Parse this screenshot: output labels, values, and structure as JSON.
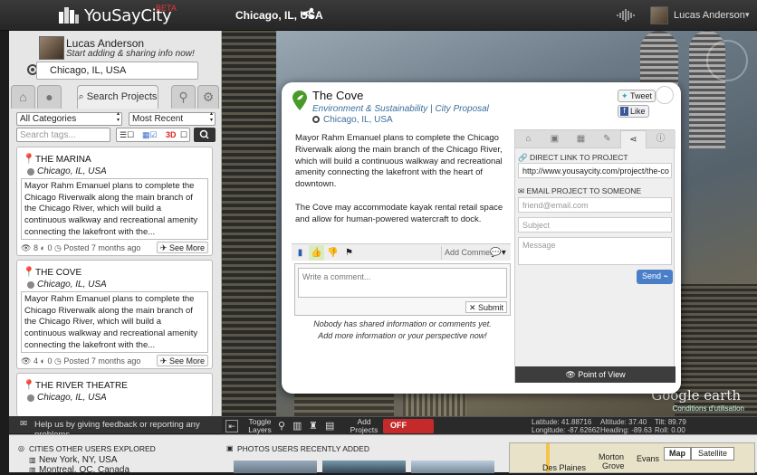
{
  "header": {
    "brand": "YouSayCity",
    "beta": "BETA",
    "location": "Chicago, IL, USA",
    "user_name": "Lucas Anderson"
  },
  "sidebar": {
    "user_name": "Lucas Anderson",
    "tagline": "Start adding & sharing info now!",
    "location_value": "Chicago, IL, USA",
    "tabs": [
      "home",
      "user",
      "Search Projects",
      "pin",
      "settings"
    ],
    "active_tab": "Search Projects",
    "category_select": "All Categories",
    "sort_select": "Most Recent",
    "tags_placeholder": "Search tags...",
    "toggle_3d": "3D",
    "projects": [
      {
        "title": "THE MARINA",
        "location": "Chicago, IL, USA",
        "body": "Mayor Rahm Emanuel plans to complete the Chicago Riverwalk along the main branch of the Chicago River, which will build a continuous walkway and recreational amenity connecting the lakefront with the...",
        "views": "8",
        "comments": "0",
        "posted": "Posted 7 months ago",
        "see_more": "See More"
      },
      {
        "title": "THE COVE",
        "location": "Chicago, IL, USA",
        "body": "Mayor Rahm Emanuel plans to complete the Chicago Riverwalk along the main branch of the Chicago River, which will build a continuous walkway and recreational amenity connecting the lakefront with the...",
        "views": "4",
        "comments": "0",
        "posted": "Posted 7 months ago",
        "see_more": "See More"
      },
      {
        "title": "THE RIVER THEATRE",
        "location": "Chicago, IL, USA"
      }
    ],
    "feedback": "Help us by giving feedback or reporting any problems"
  },
  "popup": {
    "title": "The Cove",
    "category": "Environment & Sustainability | City Proposal",
    "location": "Chicago, IL, USA",
    "tweet": "Tweet",
    "like": "Like",
    "description_1": "Mayor Rahm Emanuel plans to complete the Chicago Riverwalk along the main branch of the Chicago River, which will build a continuous walkway and recreational amenity connecting the lakefront with the heart of downtown.",
    "description_2": "The Cove may accommodate kayak rental retail space and allow for human-powered watercraft to dock.",
    "add_comment": "Add Comment",
    "comment_placeholder": "Write a comment...",
    "submit": "Submit",
    "nobody_1": "Nobody has shared information or comments yet.",
    "nobody_2": "Add more information or your perspective now!",
    "direct_link_label": "DIRECT LINK TO PROJECT",
    "direct_link_value": "http://www.yousaycity.com/project/the-co",
    "email_label": "EMAIL PROJECT TO SOMEONE",
    "email_placeholder": "friend@email.com",
    "subject_placeholder": "Subject",
    "message_placeholder": "Message",
    "send": "Send",
    "point_of_view": "Point of View"
  },
  "map": {
    "google_earth": "Google earth",
    "conditions": "Conditions d'utilisation",
    "toggle_layers": "Toggle Layers",
    "add_projects": "Add Projects",
    "off": "OFF",
    "latitude": "Latitude: 41.88716",
    "longitude": "Longitude: -87.62662",
    "altitude": "Altitude: 37.40",
    "heading": "Heading: -89.63",
    "tilt": "Tilt: 89.79",
    "roll": "Roll: 0.00"
  },
  "bottom": {
    "cities_title": "CITIES OTHER USERS EXPLORED",
    "city_1": "New York, NY, USA",
    "city_2": "Montreal, QC, Canada",
    "photos_title": "PHOTOS USERS RECENTLY ADDED",
    "map_btn": "Map",
    "satellite_btn": "Satellite",
    "place_1": "Morton",
    "place_2": "Grove",
    "place_3": "Evans",
    "place_4": "Des Plaines"
  }
}
